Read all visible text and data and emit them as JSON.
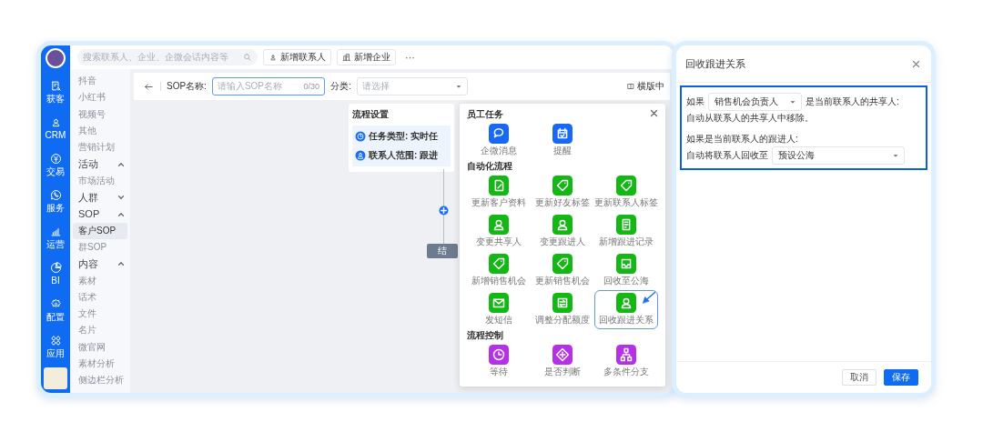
{
  "rail": {
    "items": [
      {
        "label": "获客"
      },
      {
        "label": "CRM"
      },
      {
        "label": "交易"
      },
      {
        "label": "服务"
      },
      {
        "label": "运营"
      },
      {
        "label": "BI"
      },
      {
        "label": "配置"
      },
      {
        "label": "应用"
      }
    ]
  },
  "topbar": {
    "search": {
      "placeholder": "搜索联系人、企业、企微会话内容等"
    },
    "buttons": [
      {
        "label": "新增联系人"
      },
      {
        "label": "新增企业"
      }
    ],
    "more": "···"
  },
  "subnav": [
    {
      "kind": "item",
      "label": "抖音",
      "selected": false
    },
    {
      "kind": "item",
      "label": "小红书",
      "selected": false
    },
    {
      "kind": "item",
      "label": "视频号",
      "selected": false
    },
    {
      "kind": "item",
      "label": "其他",
      "selected": false
    },
    {
      "kind": "item",
      "label": "营销计划",
      "selected": false
    },
    {
      "kind": "group",
      "label": "活动",
      "expanded": true,
      "children": [
        {
          "label": "市场活动",
          "selected": false
        }
      ]
    },
    {
      "kind": "group",
      "label": "人群",
      "expanded": false
    },
    {
      "kind": "group",
      "label": "SOP",
      "expanded": true,
      "children": [
        {
          "label": "客户SOP",
          "selected": true
        },
        {
          "label": "群SOP",
          "selected": false
        }
      ]
    },
    {
      "kind": "group",
      "label": "内容",
      "expanded": true,
      "children": [
        {
          "label": "素材",
          "selected": false
        },
        {
          "label": "话术",
          "selected": false
        },
        {
          "label": "文件",
          "selected": false
        },
        {
          "label": "名片",
          "selected": false
        },
        {
          "label": "微官网",
          "selected": false
        },
        {
          "label": "素材分析",
          "selected": false
        },
        {
          "label": "侧边栏分析",
          "selected": false
        }
      ]
    }
  ],
  "toolbar": {
    "name_label": "SOP名称:",
    "name_input": {
      "placeholder": "请输入SOP名称",
      "counter": "0/30"
    },
    "category_label": "分类:",
    "category_select": {
      "placeholder": "请选择"
    },
    "layout_toggle": "横版中"
  },
  "flow": {
    "card_title": "流程设置",
    "rows": [
      {
        "kind": "task_type",
        "text": "任务类型: 实时任"
      },
      {
        "kind": "contact_scope",
        "text": "联系人范围: 跟进"
      }
    ],
    "end_button": "结"
  },
  "popup": {
    "sections": [
      {
        "title": "员工任务",
        "color": "#1769f5",
        "items": [
          {
            "label": "企微消息",
            "highlighted": false
          },
          {
            "label": "提醒",
            "highlighted": false
          }
        ]
      },
      {
        "title": "自动化流程",
        "color": "#14b814",
        "items": [
          {
            "label": "更新客户资料",
            "highlighted": false
          },
          {
            "label": "更新好友标签",
            "highlighted": false
          },
          {
            "label": "更新联系人标签",
            "highlighted": false
          },
          {
            "label": "变更共享人",
            "highlighted": false
          },
          {
            "label": "变更跟进人",
            "highlighted": false
          },
          {
            "label": "新增跟进记录",
            "highlighted": false
          },
          {
            "label": "新增销售机会",
            "highlighted": false
          },
          {
            "label": "更新销售机会",
            "highlighted": false
          },
          {
            "label": "回收至公海",
            "highlighted": false
          },
          {
            "label": "发短信",
            "highlighted": false
          },
          {
            "label": "调整分配额度",
            "highlighted": false
          },
          {
            "label": "回收跟进关系",
            "highlighted": true
          }
        ]
      },
      {
        "title": "流程控制",
        "color": "#b531e8",
        "items": [
          {
            "label": "等待",
            "highlighted": false
          },
          {
            "label": "是否判断",
            "highlighted": false
          },
          {
            "label": "多条件分支",
            "highlighted": false
          }
        ]
      }
    ]
  },
  "dialog": {
    "title": "回收跟进关系",
    "line1_prefix": "如果",
    "role_select": "销售机会负责人",
    "line1_suffix": "是当前联系人的共享人:",
    "line2": "自动从联系人的共享人中移除。",
    "line3": "如果是当前联系人的跟进人:",
    "line4_prefix": "自动将联系人回收至",
    "pool_select": "预设公海",
    "buttons": [
      {
        "label": "取消",
        "kind": "secondary"
      },
      {
        "label": "保存",
        "kind": "primary"
      }
    ]
  }
}
